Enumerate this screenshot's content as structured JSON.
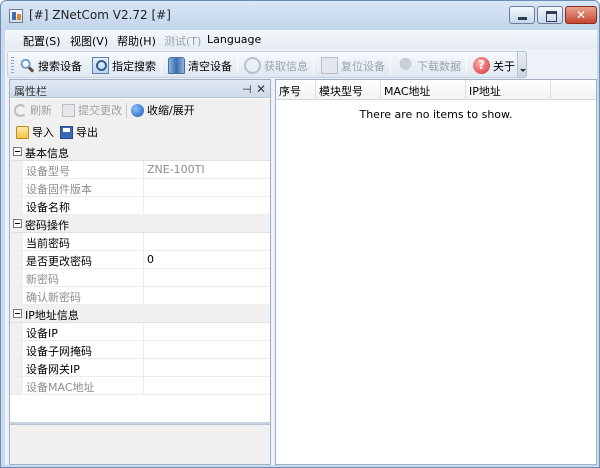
{
  "window": {
    "title": "[#] ZNetCom V2.72 [#]"
  },
  "menu": [
    {
      "label": "配置(S)",
      "disabled": false
    },
    {
      "label": "视图(V)",
      "disabled": false
    },
    {
      "label": "帮助(H)",
      "disabled": false
    },
    {
      "label": "测试(T)",
      "disabled": true
    },
    {
      "label": "Language",
      "disabled": false
    }
  ],
  "toolbar": {
    "search_devices": "搜索设备",
    "specify_search": "指定搜索",
    "clear_devices": "清空设备",
    "get_info": "获取信息",
    "reset_device": "复位设备",
    "download_data": "下载数据",
    "about": "关于"
  },
  "icons": {
    "search": "magnifier-icon",
    "specify": "target-search-icon",
    "clear": "trash-can-icon",
    "get_info": "info-refresh-icon",
    "reset": "reset-icon",
    "download": "download-icon",
    "about": "help-icon"
  },
  "property_panel": {
    "title": "属性栏",
    "pin": "⊣",
    "close": "✕",
    "refresh": "刷新",
    "submit_changes": "提交更改",
    "collapse_expand": "收缩/展开",
    "import": "导入",
    "export": "导出",
    "categories": [
      {
        "label": "基本信息",
        "rows": [
          {
            "name": "设备型号",
            "value": "ZNE-100TI",
            "dim": true
          },
          {
            "name": "设备固件版本",
            "value": "",
            "dim": true
          },
          {
            "name": "设备名称",
            "value": "",
            "dim": false
          }
        ]
      },
      {
        "label": "密码操作",
        "rows": [
          {
            "name": "当前密码",
            "value": "",
            "dim": false
          },
          {
            "name": "是否更改密码",
            "value": "0",
            "dim": false
          },
          {
            "name": "新密码",
            "value": "",
            "dim": true
          },
          {
            "name": "确认新密码",
            "value": "",
            "dim": true
          }
        ]
      },
      {
        "label": "IP地址信息",
        "rows": [
          {
            "name": "设备IP",
            "value": "",
            "dim": false
          },
          {
            "name": "设备子网掩码",
            "value": "",
            "dim": false
          },
          {
            "name": "设备网关IP",
            "value": "",
            "dim": false
          },
          {
            "name": "设备MAC地址",
            "value": "",
            "dim": true
          }
        ]
      }
    ]
  },
  "device_list": {
    "columns": [
      "序号",
      "模块型号",
      "MAC地址",
      "IP地址"
    ],
    "empty_text": "There are no items to show."
  },
  "colors": {
    "title_bar": "#c9daee",
    "close_button": "#c54632",
    "panel_border": "#9fb0c6",
    "disabled_text": "#9aa3ad"
  }
}
